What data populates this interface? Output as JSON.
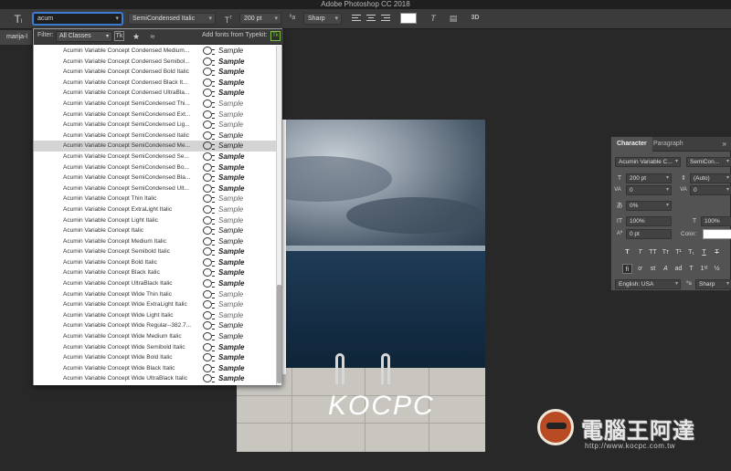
{
  "app": {
    "title": "Adobe Photoshop CC 2018"
  },
  "options_bar": {
    "font_search_value": "acum",
    "font_style": "SemiCondensed Italic",
    "font_size": "200 pt",
    "anti_alias": "Sharp"
  },
  "document": {
    "tab_label": "marija-l"
  },
  "font_panel": {
    "filter_label": "Filter:",
    "filter_value": "All Classes",
    "typekit_label": "Add fonts from Typekit:",
    "typekit_button": "Tk",
    "sample_text": "Sample",
    "selected_index": 9,
    "fonts": [
      "Acumin Variable Concept Condensed Medium...",
      "Acumin Variable Concept Condensed Semibol...",
      "Acumin Variable Concept Condensed Bold Italic",
      "Acumin Variable Concept Condensed Black It...",
      "Acumin Variable Concept Condensed UltraBla...",
      "Acumin Variable Concept SemiCondensed Thi...",
      "Acumin Variable Concept SemiCondensed Ext...",
      "Acumin Variable Concept SemiCondensed Lig...",
      "Acumin Variable Concept SemiCondensed Italic",
      "Acumin Variable Concept SemiCondensed Me...",
      "Acumin Variable Concept SemiCondensed Se...",
      "Acumin Variable Concept SemiCondensed Bo...",
      "Acumin Variable Concept SemiCondensed Bla...",
      "Acumin Variable Concept SemiCondensed Ult...",
      "Acumin Variable Concept Thin Italic",
      "Acumin Variable Concept ExtraLight Italic",
      "Acumin Variable Concept Light Italic",
      "Acumin Variable Concept Italic",
      "Acumin Variable Concept Medium Italic",
      "Acumin Variable Concept Semibold Italic",
      "Acumin Variable Concept Bold Italic",
      "Acumin Variable Concept Black Italic",
      "Acumin Variable Concept UltraBlack Italic",
      "Acumin Variable Concept Wide Thin Italic",
      "Acumin Variable Concept Wide ExtraLight Italic",
      "Acumin Variable Concept Wide Light Italic",
      "Acumin Variable Concept Wide Regular--382.7...",
      "Acumin Variable Concept Wide Medium Italic",
      "Acumin Variable Concept Wide Semibold Italic",
      "Acumin Variable Concept Wide Bold Italic",
      "Acumin Variable Concept Wide Black Italic",
      "Acumin Variable Concept Wide UltraBlack Italic"
    ],
    "sample_weights": [
      500,
      600,
      700,
      800,
      900,
      200,
      300,
      300,
      400,
      500,
      600,
      700,
      800,
      900,
      200,
      300,
      300,
      400,
      500,
      600,
      700,
      800,
      900,
      200,
      300,
      300,
      400,
      500,
      600,
      700,
      800,
      900
    ]
  },
  "canvas": {
    "overlay_text": "KOCPC"
  },
  "character_panel": {
    "tab_character": "Character",
    "tab_paragraph": "Paragraph",
    "font_family": "Acumin Variable C...",
    "font_style": "SemiCon...",
    "font_size": "200 pt",
    "leading": "(Auto)",
    "kerning": "0",
    "tracking": "0",
    "scale_percent": "0%",
    "vertical_scale": "100%",
    "horizontal_scale": "100%",
    "baseline_shift": "0 pt",
    "color_label": "Color:",
    "color_value": "#ffffff",
    "language": "English: USA",
    "anti_alias": "Sharp"
  },
  "watermark": {
    "brand": "電腦王阿達",
    "url": "http://www.kocpc.com.tw"
  }
}
